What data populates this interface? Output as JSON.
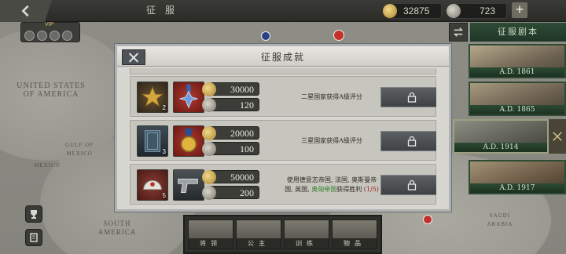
{
  "topbar": {
    "title": "征服",
    "gold_amount": "32875",
    "medal_amount": "723",
    "plus_label": "+"
  },
  "vip": {
    "label": "VIP"
  },
  "map": {
    "labels": [
      "UNITED STATES OF AMERICA",
      "GULF OF MEXICO",
      "SOUTH AMERICA",
      "SAUDI ARABIA",
      "MEXICO"
    ]
  },
  "scenarios": {
    "header": "征服剧本",
    "items": [
      {
        "year": "A.D. 1861"
      },
      {
        "year": "A.D. 1865"
      },
      {
        "year": "A.D. 1914"
      },
      {
        "year": "A.D. 1917"
      }
    ]
  },
  "bottom_tabs": [
    {
      "label": "将领"
    },
    {
      "label": "公主"
    },
    {
      "label": "训练"
    },
    {
      "label": "物品"
    }
  ],
  "modal": {
    "title": "征服成就",
    "rows": [
      {
        "item1_count": "2",
        "gold": "30000",
        "medals": "120",
        "condition": "二星国家获得A级评分"
      },
      {
        "item1_count": "3",
        "gold": "20000",
        "medals": "100",
        "condition": "三星国家获得A级评分"
      },
      {
        "item1_count": "5",
        "gold": "50000",
        "medals": "200",
        "condition_a": "使用德意志帝国, 法国, 奥斯曼帝国, 英国, ",
        "condition_hl": "奥匈帝国",
        "condition_b": "获得胜利",
        "condition_prog": "(1/5)"
      }
    ]
  },
  "colors": {
    "accent_green": "#2f7f2a",
    "progress_red": "#a0261e",
    "gold_coin": "#c9a44a"
  }
}
